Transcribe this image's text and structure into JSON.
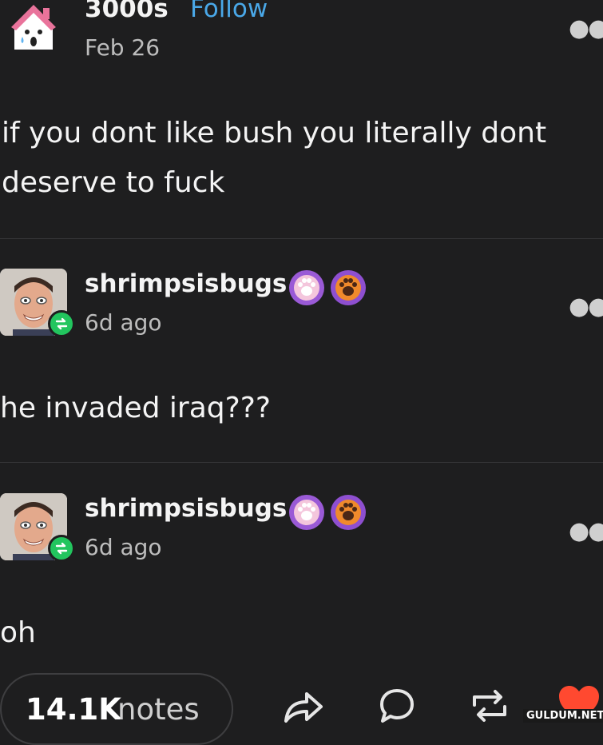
{
  "post": {
    "username": "3000s",
    "follow_label": "Follow",
    "date": "Feb 26",
    "text": "if you dont like bush you literally dont deserve to fuck",
    "avatar_icon": "house-avatar-icon",
    "more_icon": "more-options-icon"
  },
  "reblogs": [
    {
      "username": "shrimpsisbugs",
      "time": "6d ago",
      "text": "he invaded iraq???",
      "badges": [
        "pink-paw-badge-icon",
        "orange-paw-badge-icon"
      ]
    },
    {
      "username": "shrimpsisbugs",
      "time": "6d ago",
      "text": "oh",
      "badges": [
        "pink-paw-badge-icon",
        "orange-paw-badge-icon"
      ]
    }
  ],
  "footer": {
    "notes_count": "14.1K",
    "notes_label": "notes",
    "actions": [
      "share-icon",
      "reply-icon",
      "reblog-icon",
      "like-icon"
    ]
  },
  "watermark": "GULDUM.NET",
  "colors": {
    "background": "#1e1e1f",
    "follow": "#4aa8e8",
    "reblog_badge": "#22c55e",
    "like": "#ff4930"
  }
}
